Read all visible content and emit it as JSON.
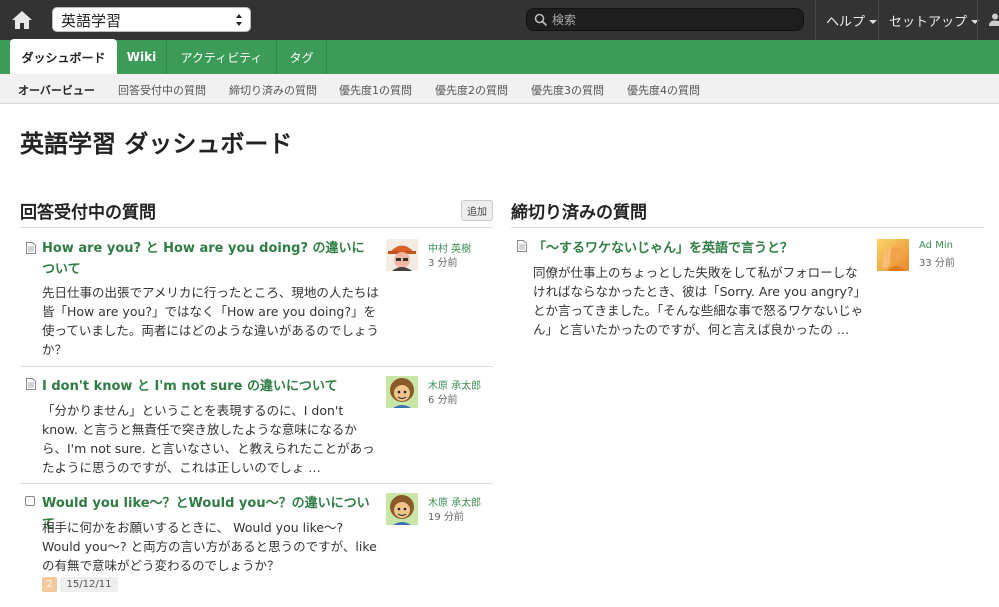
{
  "topbar": {
    "project": "英語学習",
    "search_placeholder": "検索",
    "menus": [
      "ヘルプ",
      "セットアップ"
    ]
  },
  "tabs": [
    "ダッシュボード",
    "Wiki",
    "アクティビティ",
    "タグ"
  ],
  "subnav": [
    "オーバービュー",
    "回答受付中の質問",
    "締切り済みの質問",
    "優先度1の質問",
    "優先度2の質問",
    "優先度3の質問",
    "優先度4の質問"
  ],
  "page_title": "英語学習 ダッシュボード",
  "open_section": {
    "title": "回答受付中の質問",
    "add_label": "追加",
    "items": [
      {
        "title": "How are you? と How are you doing? の違いについて",
        "body": "先日仕事の出張でアメリカに行ったところ、現地の人たちは皆「How are you?」ではなく「How are you doing?」を使っていました。両者にはどのような違いがあるのでしょうか？",
        "author": "中村 英樹",
        "ago": "3 分前"
      },
      {
        "title": "I don't know と I'm not sure の違いについて",
        "body": "「分かりません」ということを表現するのに、I don't know. と言うと無責任で突き放したような意味になるから、I'm not sure. と言いなさい、と教えられたことがあったように思うのですが、これは正しいのでしょ …",
        "author": "木原 承太郎",
        "ago": "6 分前"
      },
      {
        "title": "Would you like〜？とWould you〜？の違いについて",
        "body": "相手に何かをお願いするときに、 Would you like〜? Would you〜? と両方の言い方があると思うのですが、likeの有無で意味がどう変わるのでしょうか？",
        "author": "木原 承太郎",
        "ago": "19 分前",
        "badge": "2",
        "date": "15/12/11"
      }
    ]
  },
  "closed_section": {
    "title": "締切り済みの質問",
    "items": [
      {
        "title": "「〜するワケないじゃん」を英語で言うと？",
        "body": "同僚が仕事上のちょっとした失敗をして私がフォローしなければならなかったとき、彼は「Sorry. Are you angry?」とか言ってきました。「そんな些細な事で怒るワケないじゃん」と言いたかったのですが、何と言えば良かったの …",
        "author": "Ad Min",
        "ago": "33 分前"
      }
    ]
  },
  "colors": {
    "topbar": "#333333",
    "accent_green": "#3c9b57",
    "link_green": "#2f7d44"
  }
}
